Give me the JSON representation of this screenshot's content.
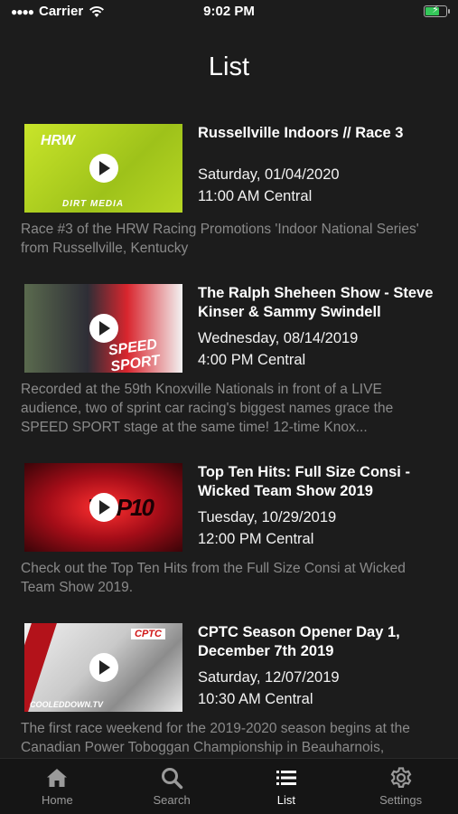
{
  "status_bar": {
    "carrier": "Carrier",
    "time": "9:02 PM",
    "battery_level": 0.72,
    "battery_color": "#34c759"
  },
  "header": {
    "title": "List"
  },
  "list": {
    "items": [
      {
        "thumbnail_text_a": "HRW",
        "thumbnail_text_b": "DIRT MEDIA",
        "title": "Russellville Indoors // Race 3",
        "date": "Saturday, 01/04/2020",
        "time": "11:00 AM Central",
        "description": "Race #3 of the HRW Racing Promotions 'Indoor National Series' from Russellville, Kentucky"
      },
      {
        "thumbnail_text_a": "SPEED SPORT",
        "title": "The Ralph Sheheen Show - Steve Kinser & Sammy Swindell",
        "date": "Wednesday, 08/14/2019",
        "time": "4:00 PM Central",
        "description": "Recorded at the 59th Knoxville Nationals in front of a LIVE audience, two of sprint car racing's biggest names grace the SPEED SPORT stage at the same time! 12-time Knox..."
      },
      {
        "thumbnail_text_a": "TOP10",
        "title": "Top Ten Hits: Full Size Consi - Wicked Team Show 2019",
        "date": "Tuesday, 10/29/2019",
        "time": "12:00 PM Central",
        "description": "Check out the Top Ten Hits from the Full Size Consi at Wicked Team Show 2019."
      },
      {
        "thumbnail_text_a": "CPTC",
        "thumbnail_text_b": "COOLEDDOWN.TV",
        "title": "CPTC Season Opener Day 1, December 7th 2019",
        "date": "Saturday, 12/07/2019",
        "time": "10:30 AM Central",
        "description": "The first race weekend for the 2019-2020 season begins at the Canadian Power Toboggan Championship in Beauharnois, Quebec. Watch the snowmobile racing action unfold..."
      }
    ]
  },
  "tabbar": {
    "tabs": [
      {
        "label": "Home",
        "icon": "home-icon"
      },
      {
        "label": "Search",
        "icon": "search-icon"
      },
      {
        "label": "List",
        "icon": "list-icon",
        "active": true
      },
      {
        "label": "Settings",
        "icon": "gear-icon"
      }
    ]
  }
}
